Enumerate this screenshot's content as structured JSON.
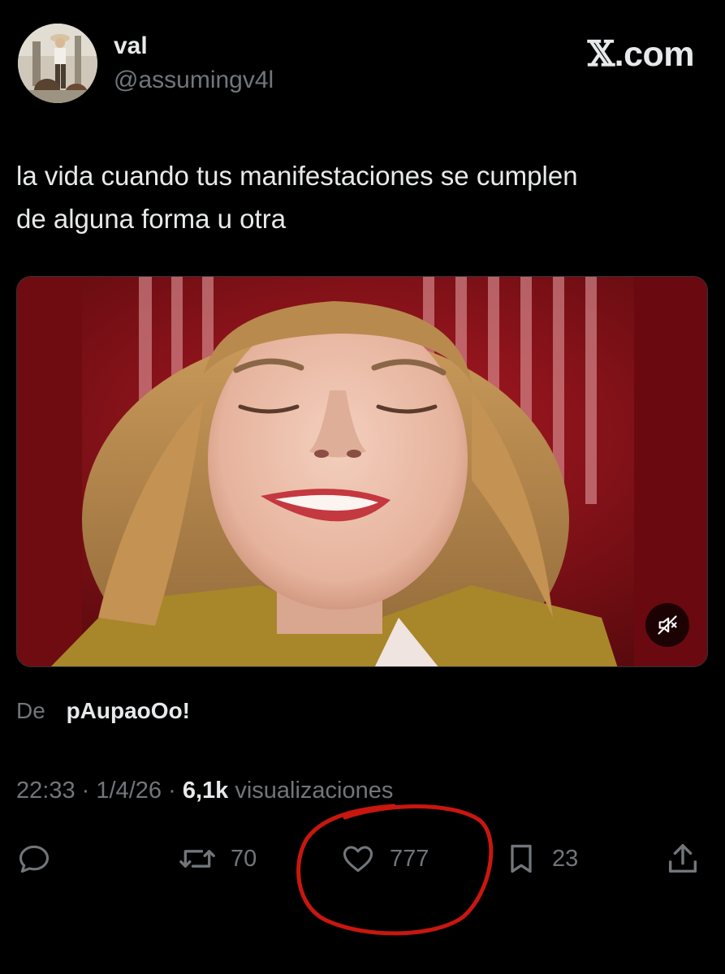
{
  "header": {
    "display_name": "val",
    "handle": "@assumingv4l",
    "site_label_mark": "𝕏",
    "site_label_suffix": ".com",
    "avatar_icon": "profile-photo-icon"
  },
  "tweet": {
    "text_line1": "la vida cuando tus manifestaciones se cumplen",
    "text_line2": "de alguna forma u otra"
  },
  "media": {
    "type": "video",
    "mute_icon": "muted-speaker-icon"
  },
  "source": {
    "prefix": "De",
    "name": "pAupaoOo!"
  },
  "meta": {
    "time": "22:33",
    "separator": "·",
    "date": "1/4/26",
    "views_count": "6,1k",
    "views_label": "visualizaciones"
  },
  "actions": {
    "reply": {
      "icon": "reply-icon",
      "count": ""
    },
    "retweet": {
      "icon": "retweet-icon",
      "count": "70"
    },
    "like": {
      "icon": "heart-icon",
      "count": "777"
    },
    "bookmark": {
      "icon": "bookmark-icon",
      "count": "23"
    },
    "share": {
      "icon": "share-icon",
      "count": ""
    }
  },
  "colors": {
    "background": "#000000",
    "primary_text": "#e7e9ea",
    "secondary_text": "#71767b",
    "annotation": "#c8170f"
  }
}
